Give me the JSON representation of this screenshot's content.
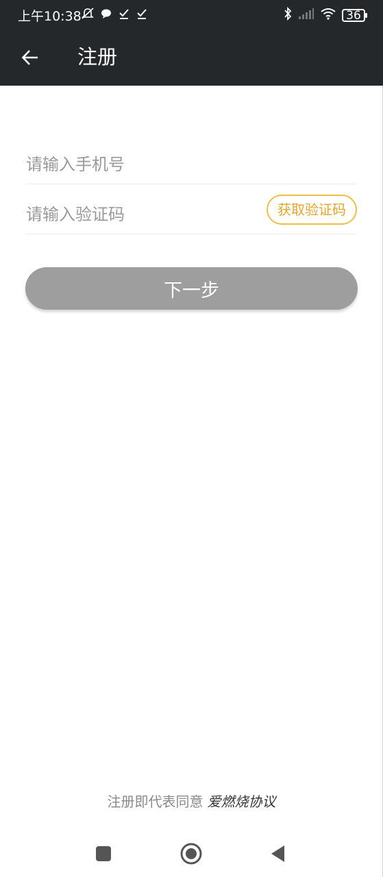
{
  "status_bar": {
    "time": "上午10:38",
    "battery": "36",
    "left_icons": [
      "bell-off-icon",
      "chat-bubble-icon",
      "check-icon",
      "check-icon"
    ],
    "right_icons": [
      "bluetooth-icon",
      "signal-icon",
      "wifi-icon",
      "battery-icon"
    ]
  },
  "toolbar": {
    "title": "注册",
    "back_icon": "arrow-left-icon"
  },
  "form": {
    "phone_placeholder": "请输入手机号",
    "phone_value": "",
    "code_placeholder": "请输入验证码",
    "code_value": "",
    "get_code_label": "获取验证码"
  },
  "next_button": {
    "label": "下一步"
  },
  "agreement": {
    "prefix": "注册即代表同意",
    "link": "爱燃烧协议"
  },
  "nav_bar": {
    "icons": [
      "square-icon",
      "circle-home-icon",
      "triangle-back-icon"
    ]
  },
  "colors": {
    "header_bg": "#24282b",
    "accent": "#f0bf41",
    "button_disabled": "#9e9e9e",
    "placeholder": "#9a9a9a"
  }
}
